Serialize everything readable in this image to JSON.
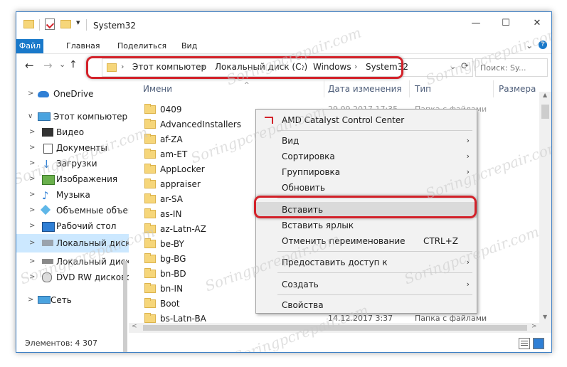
{
  "window": {
    "title": "System32",
    "controls": {
      "minimize": "—",
      "maximize": "☐",
      "close": "✕"
    }
  },
  "ribbon": {
    "tabs": [
      "Файл",
      "Главная",
      "Поделиться",
      "Вид"
    ],
    "expand": "⌄",
    "help": "?"
  },
  "nav_buttons": {
    "back": "←",
    "forward": "→",
    "down": "⌄",
    "up": "↑",
    "refresh": "⟳"
  },
  "address": {
    "breadcrumbs": [
      "Этот компьютер",
      "Локальный диск (C:)",
      "Windows",
      "System32"
    ],
    "separator": "›",
    "dropdown": "⌄"
  },
  "search": {
    "placeholder": "Поиск: Sy..."
  },
  "sidebar": {
    "items": [
      {
        "label": "OneDrive",
        "icon": "cloud-icon"
      },
      {
        "label": "Этот компьютер",
        "icon": "computer-icon"
      },
      {
        "label": "Видео",
        "icon": "video-icon"
      },
      {
        "label": "Документы",
        "icon": "documents-icon"
      },
      {
        "label": "Загрузки",
        "icon": "download-icon"
      },
      {
        "label": "Изображения",
        "icon": "pictures-icon"
      },
      {
        "label": "Музыка",
        "icon": "music-icon"
      },
      {
        "label": "Объемные объекты",
        "icon": "3d-objects-icon"
      },
      {
        "label": "Рабочий стол",
        "icon": "desktop-icon"
      },
      {
        "label": "Локальный диск (C:)",
        "icon": "drive-windows-icon"
      },
      {
        "label": "Локальный диск (D:)",
        "icon": "drive-icon"
      },
      {
        "label": "DVD RW дисковод",
        "icon": "dvd-icon"
      },
      {
        "label": "Сеть",
        "icon": "network-icon"
      }
    ]
  },
  "columns": {
    "name": "Имени",
    "date": "Дата изменения",
    "type": "Тип",
    "size": "Размера"
  },
  "files": [
    "0409",
    "AdvancedInstallers",
    "af-ZA",
    "am-ET",
    "AppLocker",
    "appraiser",
    "ar-SA",
    "as-IN",
    "az-Latn-AZ",
    "be-BY",
    "bg-BG",
    "bn-BD",
    "bn-IN",
    "Boot",
    "bs-Latn-BA"
  ],
  "visible_meta": {
    "first_row_date": "29.09.2017 17:35",
    "last_row_date": "14.12.2017 3:37",
    "type_label": "Папка с файлами"
  },
  "context_menu": {
    "items": [
      {
        "label": "AMD Catalyst Control Center",
        "arrow": "",
        "shortcut": ""
      },
      {
        "label": "Вид",
        "arrow": "›",
        "shortcut": ""
      },
      {
        "label": "Сортировка",
        "arrow": "›",
        "shortcut": ""
      },
      {
        "label": "Группировка",
        "arrow": "›",
        "shortcut": ""
      },
      {
        "label": "Обновить",
        "arrow": "",
        "shortcut": ""
      },
      {
        "label": "Вставить",
        "arrow": "",
        "shortcut": ""
      },
      {
        "label": "Вставить ярлык",
        "arrow": "",
        "shortcut": ""
      },
      {
        "label": "Отменить переименование",
        "arrow": "",
        "shortcut": "CTRL+Z"
      },
      {
        "label": "Предоставить доступ к",
        "arrow": "›",
        "shortcut": ""
      },
      {
        "label": "Создать",
        "arrow": "›",
        "shortcut": ""
      },
      {
        "label": "Свойства",
        "arrow": "",
        "shortcut": ""
      }
    ],
    "highlighted_index": 5
  },
  "status": {
    "items_count": "Элементов: 4 307"
  },
  "watermark": "Soringpcrepair.com",
  "colors": {
    "accent": "#1979ca",
    "highlight_box": "#d3222a",
    "folder": "#f6d67a",
    "selection": "#cce8ff"
  }
}
